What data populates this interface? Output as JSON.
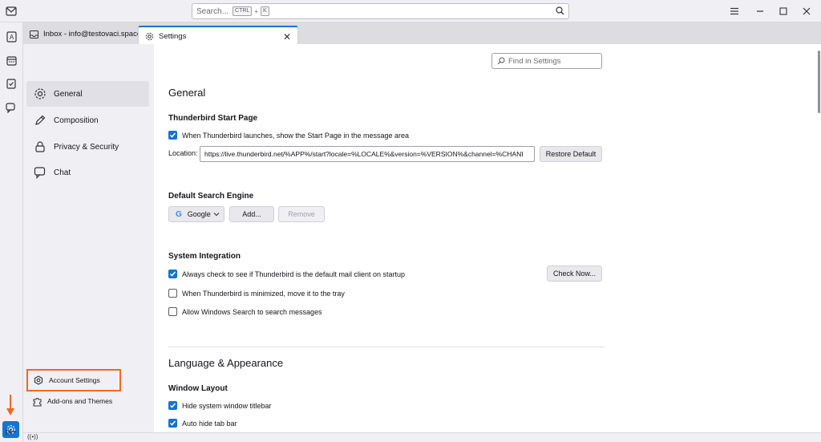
{
  "titlebar": {
    "search_placeholder": "Search...",
    "shortcut_ctrl": "CTRL",
    "shortcut_plus": "+",
    "shortcut_k": "K"
  },
  "tabs": [
    {
      "label": "Inbox - info@testovaci.space"
    },
    {
      "label": "Settings"
    }
  ],
  "sidebar": {
    "categories": [
      {
        "label": "General",
        "icon": "gear-icon"
      },
      {
        "label": "Composition",
        "icon": "pencil-icon"
      },
      {
        "label": "Privacy & Security",
        "icon": "lock-icon"
      },
      {
        "label": "Chat",
        "icon": "chat-icon"
      }
    ],
    "account_settings": "Account Settings",
    "addons": "Add-ons and Themes"
  },
  "main": {
    "find_placeholder": "Find in Settings",
    "section_general": "General",
    "start_page_heading": "Thunderbird Start Page",
    "start_page_check": "When Thunderbird launches, show the Start Page in the message area",
    "location_label": "Location:",
    "location_value": "https://live.thunderbird.net/%APP%/start?locale=%LOCALE%&version=%VERSION%&channel=%CHANI",
    "restore_default": "Restore Default",
    "search_engine_heading": "Default Search Engine",
    "search_engine_value": "Google",
    "add_button": "Add...",
    "remove_button": "Remove",
    "system_integration_heading": "System Integration",
    "always_check": "Always check to see if Thunderbird is the default mail client on startup",
    "check_now": "Check Now...",
    "minimize_tray": "When Thunderbird is minimized, move it to the tray",
    "windows_search": "Allow Windows Search to search messages",
    "section_language": "Language & Appearance",
    "window_layout_heading": "Window Layout",
    "hide_titlebar": "Hide system window titlebar",
    "auto_hide_tab": "Auto hide tab bar"
  },
  "colors": {
    "accent": "#1373d9",
    "annotation": "#f06a23"
  }
}
